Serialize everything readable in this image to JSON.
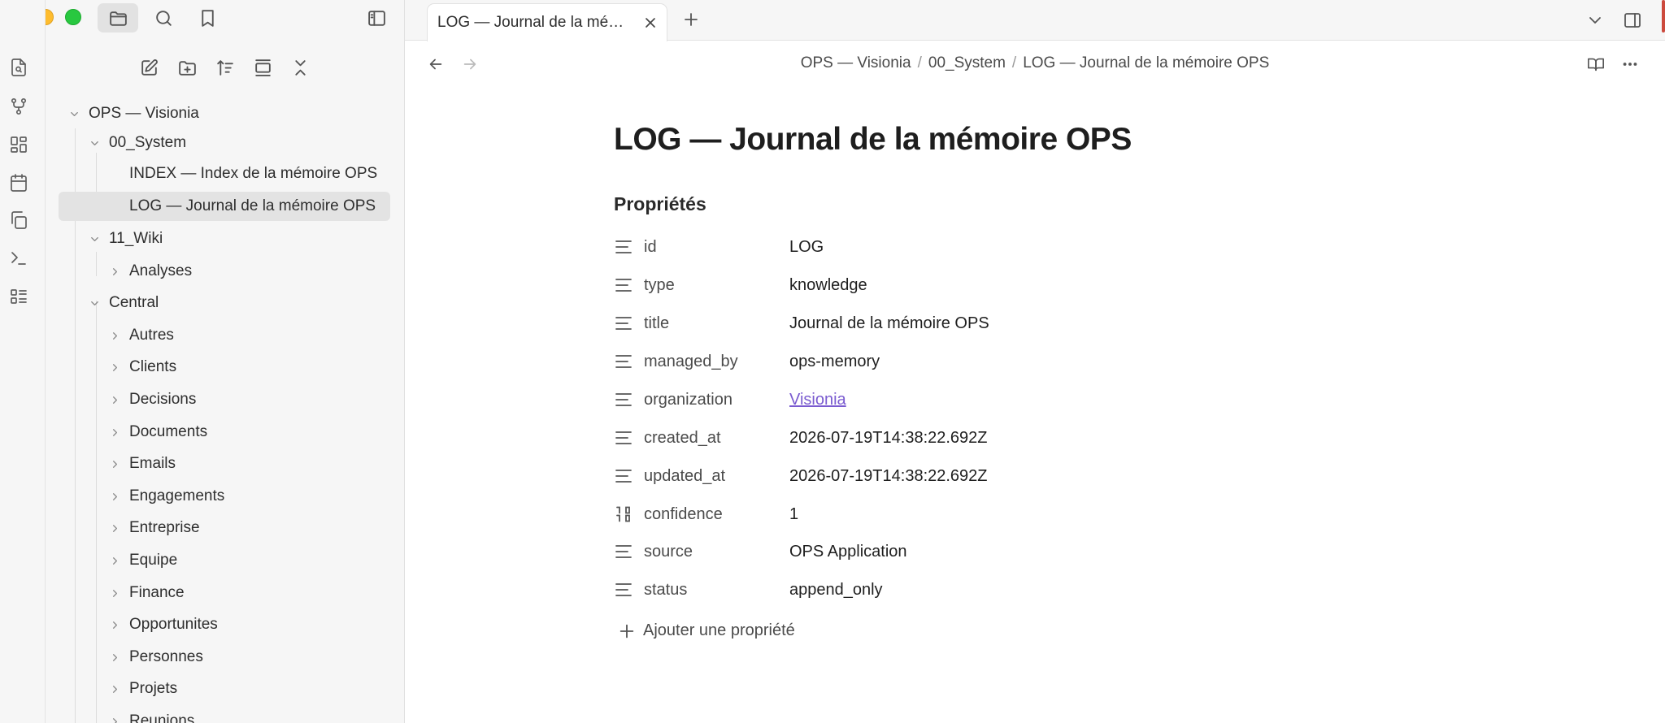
{
  "sidebar": {
    "tree": [
      {
        "label": "OPS — Visionia",
        "expanded": true
      },
      {
        "label": "00_System",
        "expanded": true
      },
      {
        "label": "INDEX — Index de la mémoire OPS"
      },
      {
        "label": "LOG — Journal de la mémoire OPS",
        "selected": true
      },
      {
        "label": "11_Wiki",
        "expanded": true
      },
      {
        "label": "Analyses",
        "expanded": false
      },
      {
        "label": "Central",
        "expanded": true
      },
      {
        "label": "Autres",
        "expanded": false
      },
      {
        "label": "Clients",
        "expanded": false
      },
      {
        "label": "Decisions",
        "expanded": false
      },
      {
        "label": "Documents",
        "expanded": false
      },
      {
        "label": "Emails",
        "expanded": false
      },
      {
        "label": "Engagements",
        "expanded": false
      },
      {
        "label": "Entreprise",
        "expanded": false
      },
      {
        "label": "Equipe",
        "expanded": false
      },
      {
        "label": "Finance",
        "expanded": false
      },
      {
        "label": "Opportunites",
        "expanded": false
      },
      {
        "label": "Personnes",
        "expanded": false
      },
      {
        "label": "Projets",
        "expanded": false
      },
      {
        "label": "Reunions",
        "expanded": false
      }
    ]
  },
  "tab": {
    "label": "LOG — Journal de la mémoire OPS"
  },
  "breadcrumb": {
    "items": [
      "OPS — Visionia",
      "00_System",
      "LOG — Journal de la mémoire OPS"
    ],
    "separator": "/"
  },
  "document": {
    "title": "LOG — Journal de la mémoire OPS",
    "properties_heading": "Propriétés",
    "properties": [
      {
        "key": "id",
        "value": "LOG",
        "icon": "text-icon"
      },
      {
        "key": "type",
        "value": "knowledge",
        "icon": "text-icon"
      },
      {
        "key": "title",
        "value": "Journal de la mémoire OPS",
        "icon": "text-icon"
      },
      {
        "key": "managed_by",
        "value": "ops-memory",
        "icon": "text-icon"
      },
      {
        "key": "organization",
        "value": "Visionia",
        "icon": "text-icon",
        "link": true
      },
      {
        "key": "created_at",
        "value": "2026-07-19T14:38:22.692Z",
        "icon": "text-icon"
      },
      {
        "key": "updated_at",
        "value": "2026-07-19T14:38:22.692Z",
        "icon": "text-icon"
      },
      {
        "key": "confidence",
        "value": "1",
        "icon": "number-icon"
      },
      {
        "key": "source",
        "value": "OPS Application",
        "icon": "text-icon"
      },
      {
        "key": "status",
        "value": "append_only",
        "icon": "text-icon"
      }
    ],
    "add_property_label": "Ajouter une propriété"
  },
  "colors": {
    "accent_link": "#7a5bd0",
    "selected_row": "#e3e3e3",
    "sidebar_bg": "#f6f6f6"
  }
}
